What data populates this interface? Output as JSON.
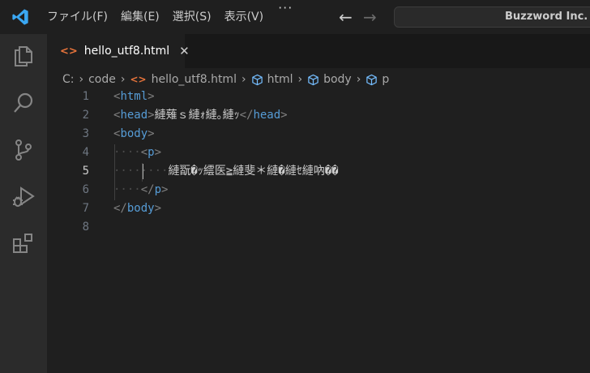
{
  "menu": {
    "items": [
      "ファイル(F)",
      "編集(E)",
      "選択(S)",
      "表示(V)"
    ],
    "more": "···"
  },
  "nav": {
    "back": "←",
    "forward": "→"
  },
  "search": {
    "text": "Buzzword Inc."
  },
  "tab": {
    "icon": "<>",
    "label": "hello_utf8.html",
    "close": "✕"
  },
  "breadcrumb": {
    "drive": "C:",
    "folder": "code",
    "file": "hello_utf8.html",
    "symbols": [
      "html",
      "body",
      "p"
    ]
  },
  "editor": {
    "active_line": 5,
    "lines": [
      {
        "num": "1",
        "open": "<",
        "tag": "html",
        "close": ">",
        "text": "",
        "endopen": "",
        "endtag": "",
        "endclose": ""
      },
      {
        "num": "2",
        "open": "<",
        "tag": "head",
        "close": ">",
        "text": "縺薙ｓ縺ｫ縺｡縺ｯ",
        "endopen": "</",
        "endtag": "head",
        "endclose": ">"
      },
      {
        "num": "3",
        "open": "<",
        "tag": "body",
        "close": ">",
        "text": "",
        "endopen": "",
        "endtag": "",
        "endclose": ""
      },
      {
        "num": "4",
        "indent": "····",
        "open": "<",
        "tag": "p",
        "close": ">",
        "text": "",
        "endopen": "",
        "endtag": "",
        "endclose": ""
      },
      {
        "num": "5",
        "indent": "········",
        "open": "",
        "tag": "",
        "close": "",
        "text": "縺翫�ｯ繧医≧縺斐＊縺�縺ｾ縺吶��",
        "endopen": "",
        "endtag": "",
        "endclose": ""
      },
      {
        "num": "6",
        "indent": "····",
        "open": "</",
        "tag": "p",
        "close": ">",
        "text": "",
        "endopen": "",
        "endtag": "",
        "endclose": ""
      },
      {
        "num": "7",
        "open": "</",
        "tag": "body",
        "close": ">",
        "text": "",
        "endopen": "",
        "endtag": "",
        "endclose": ""
      },
      {
        "num": "8",
        "open": "",
        "tag": "",
        "close": "",
        "text": "",
        "endopen": "",
        "endtag": "",
        "endclose": ""
      }
    ]
  },
  "colors": {
    "accent": "#569cd6",
    "file_icon": "#e8743b",
    "logo": "#3aa7f2"
  },
  "icons": [
    "vscode-logo-icon",
    "explorer-icon",
    "search-icon",
    "source-control-icon",
    "run-debug-icon",
    "extensions-icon",
    "html-file-icon",
    "symbol-icon"
  ]
}
